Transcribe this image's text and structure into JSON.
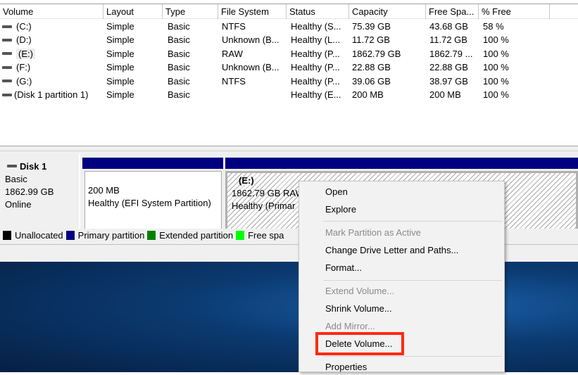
{
  "columns": [
    "Volume",
    "Layout",
    "Type",
    "File System",
    "Status",
    "Capacity",
    "Free Spa...",
    "% Free"
  ],
  "volumes": [
    {
      "volume": "(C:)",
      "layout": "Simple",
      "type": "Basic",
      "fs": "NTFS",
      "status": "Healthy (S...",
      "capacity": "75.39 GB",
      "free": "43.68 GB",
      "pct": "58 %"
    },
    {
      "volume": "(D:)",
      "layout": "Simple",
      "type": "Basic",
      "fs": "Unknown (B...",
      "status": "Healthy (L...",
      "capacity": "11.72 GB",
      "free": "11.72 GB",
      "pct": "100 %"
    },
    {
      "volume": "(E:)",
      "layout": "Simple",
      "type": "Basic",
      "fs": "RAW",
      "status": "Healthy (P...",
      "capacity": "1862.79 GB",
      "free": "1862.79 ...",
      "pct": "100 %"
    },
    {
      "volume": "(F:)",
      "layout": "Simple",
      "type": "Basic",
      "fs": "Unknown (B...",
      "status": "Healthy (P...",
      "capacity": "22.88 GB",
      "free": "22.88 GB",
      "pct": "100 %"
    },
    {
      "volume": "(G:)",
      "layout": "Simple",
      "type": "Basic",
      "fs": "NTFS",
      "status": "Healthy (P...",
      "capacity": "39.06 GB",
      "free": "38.97 GB",
      "pct": "100 %"
    },
    {
      "volume": "(Disk 1 partition 1)",
      "layout": "Simple",
      "type": "Basic",
      "fs": "",
      "status": "Healthy (E...",
      "capacity": "200 MB",
      "free": "200 MB",
      "pct": "100 %"
    }
  ],
  "disk": {
    "name": "Disk 1",
    "type": "Basic",
    "size": "1862.99 GB",
    "state": "Online",
    "partitions": [
      {
        "label": "",
        "size": "200 MB",
        "status": "Healthy (EFI System Partition)"
      },
      {
        "label": "(E:)",
        "size": "1862.79 GB RAW",
        "status": "Healthy (Primar"
      }
    ]
  },
  "legend": [
    {
      "label": "Unallocated",
      "color": "#000000"
    },
    {
      "label": "Primary partition",
      "color": "#000080"
    },
    {
      "label": "Extended partition",
      "color": "#008000"
    },
    {
      "label": "Free spa",
      "color": "#00ff00"
    }
  ],
  "menu": {
    "items": [
      "Open",
      "Explore",
      "Mark Partition as Active",
      "Change Drive Letter and Paths...",
      "Format...",
      "Extend Volume...",
      "Shrink Volume...",
      "Add Mirror...",
      "Delete Volume...",
      "Properties"
    ],
    "highlight_color": "#ff2a12"
  }
}
